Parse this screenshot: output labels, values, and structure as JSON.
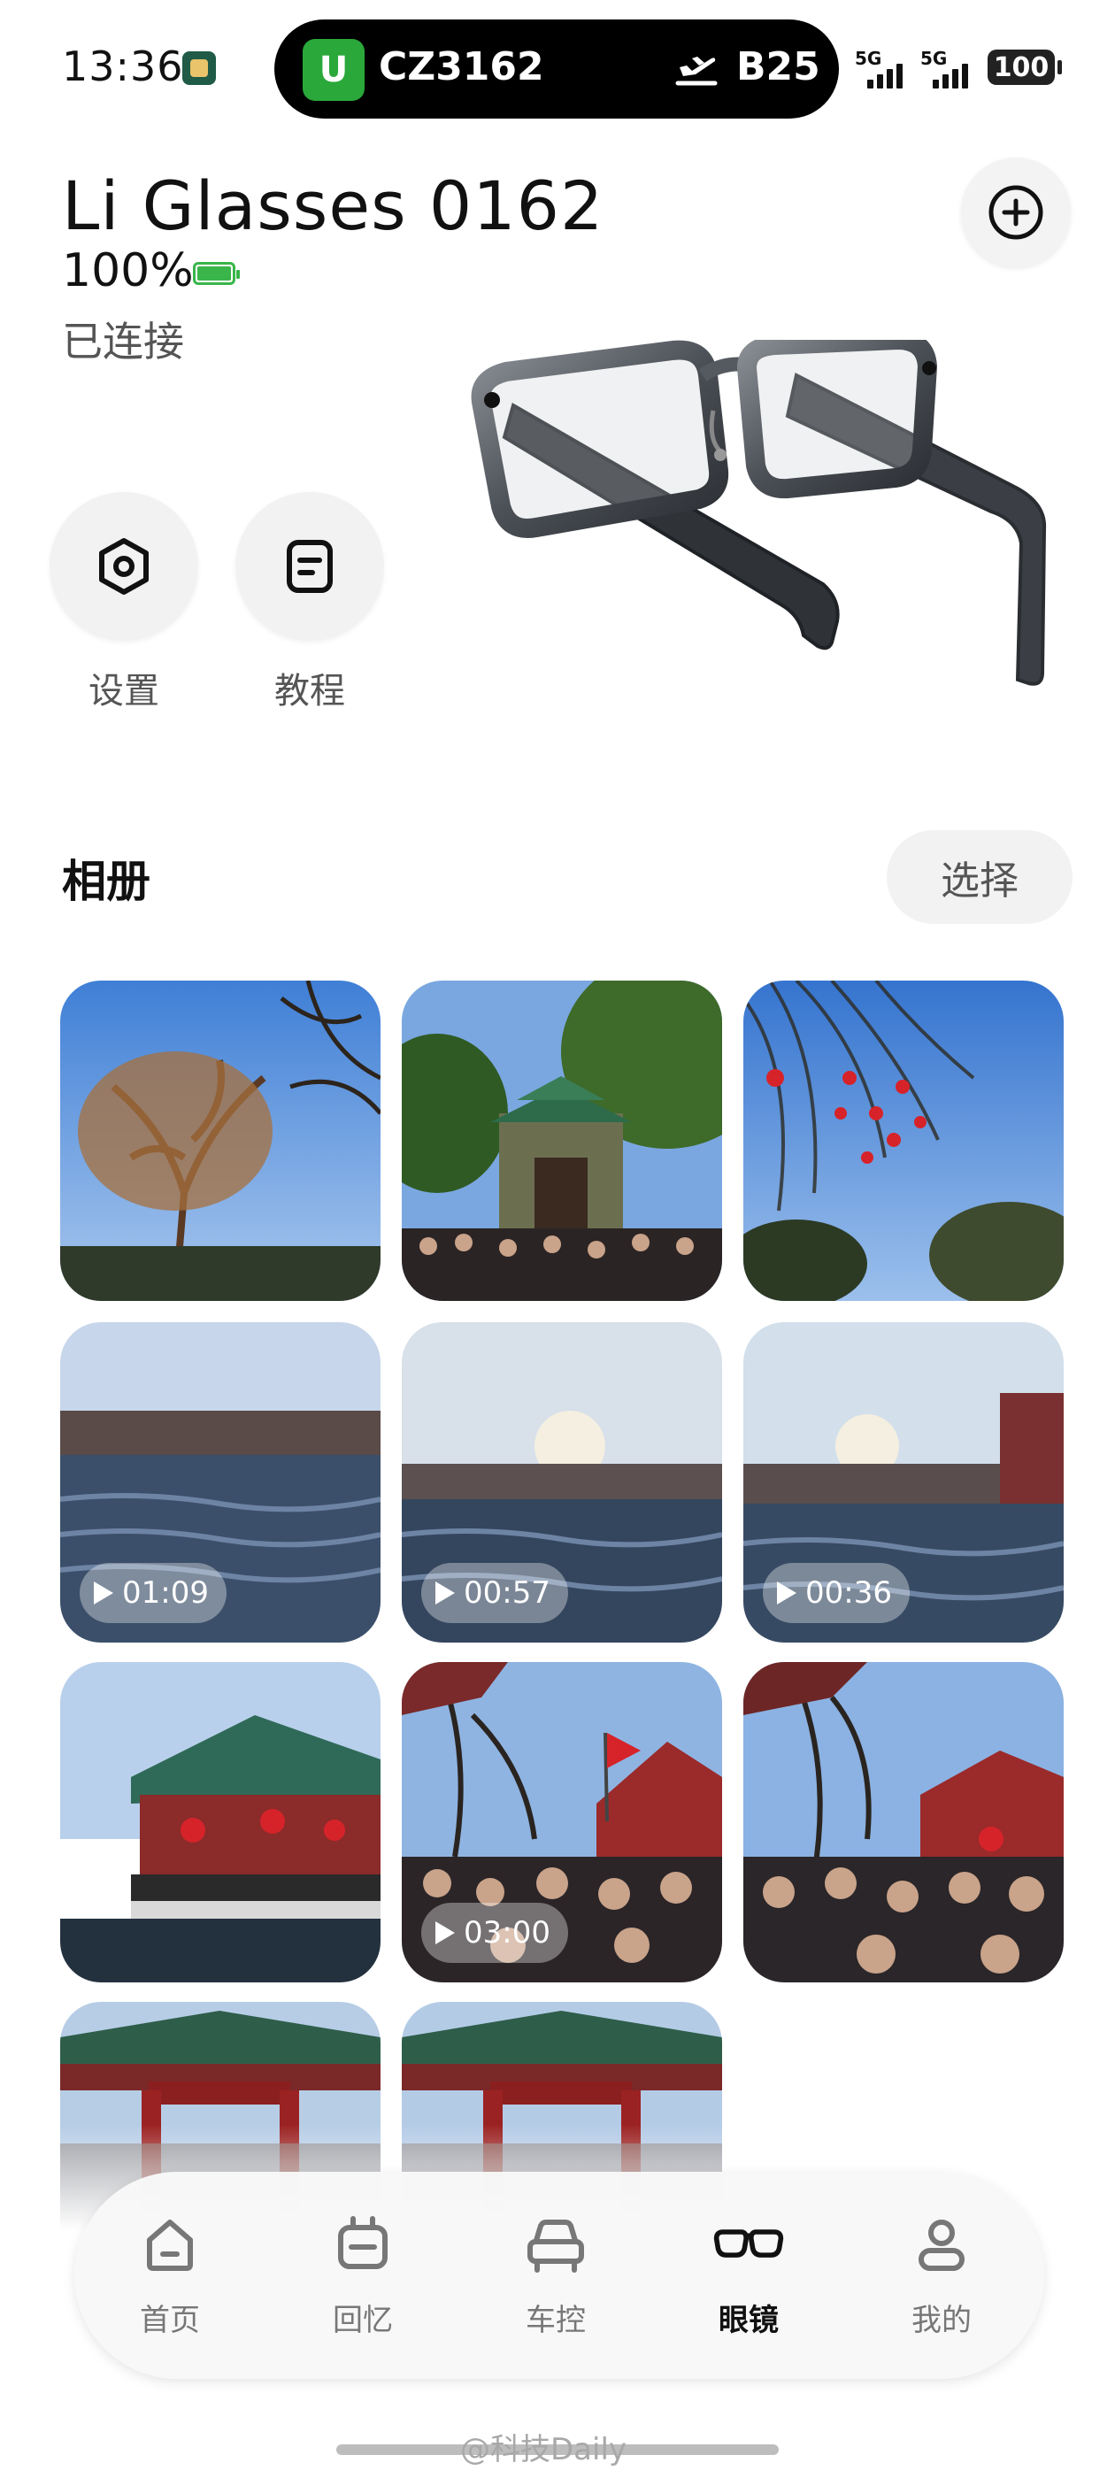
{
  "status_bar": {
    "time": "13:36",
    "flight_number": "CZ3162",
    "gate": "B25",
    "network_1": "5G",
    "network_2": "5G",
    "battery": "100",
    "airline_logo_glyph": "U"
  },
  "device": {
    "name": "Li Glasses 0162",
    "battery": "100%",
    "status": "已连接"
  },
  "quick_actions": {
    "settings_label": "设置",
    "tutorial_label": "教程"
  },
  "album": {
    "title": "相册",
    "select_label": "选择",
    "items": [
      {
        "type": "photo",
        "scene": "tree-sky"
      },
      {
        "type": "photo",
        "scene": "temple-crowd"
      },
      {
        "type": "photo",
        "scene": "willow-lanterns"
      },
      {
        "type": "video",
        "duration": "01:09",
        "scene": "pond"
      },
      {
        "type": "video",
        "duration": "00:57",
        "scene": "pond"
      },
      {
        "type": "video",
        "duration": "00:36",
        "scene": "pond"
      },
      {
        "type": "photo",
        "scene": "pavilion-water"
      },
      {
        "type": "video",
        "duration": "03:00",
        "scene": "crowd-flags"
      },
      {
        "type": "photo",
        "scene": "crowd-pavilion"
      },
      {
        "type": "photo",
        "scene": "gate"
      },
      {
        "type": "photo",
        "scene": "gate"
      }
    ]
  },
  "bottom_nav": {
    "items": [
      {
        "label": "首页",
        "icon": "home-icon"
      },
      {
        "label": "回忆",
        "icon": "memories-icon"
      },
      {
        "label": "车控",
        "icon": "car-icon"
      },
      {
        "label": "眼镜",
        "icon": "glasses-icon",
        "active": true
      },
      {
        "label": "我的",
        "icon": "profile-icon"
      }
    ]
  },
  "watermark": "@科技Daily"
}
